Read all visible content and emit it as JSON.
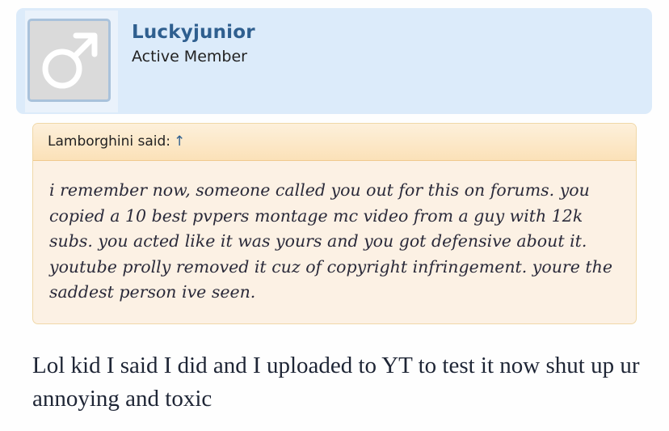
{
  "user": {
    "name": "Luckyjunior",
    "title": "Active Member",
    "avatar_icon": "male-symbol-icon"
  },
  "quote": {
    "author_label": "Lamborghini said:",
    "arrow": "↑",
    "text": "i remember now, someone called you out for this on forums. you copied a 10 best pvpers montage mc video from a guy with 12k subs. you acted like it was yours and you got defensive about it. youtube prolly removed it cuz of copyright infringement. youre the saddest person ive seen."
  },
  "message": {
    "text": "Lol kid I said I did and I uploaded to YT to test it now shut up ur annoying and toxic"
  },
  "colors": {
    "user_card_bg": "#dcebfa",
    "username": "#2f5f8f",
    "quote_bg": "#fcf1e4",
    "quote_border": "#f0c98d"
  }
}
